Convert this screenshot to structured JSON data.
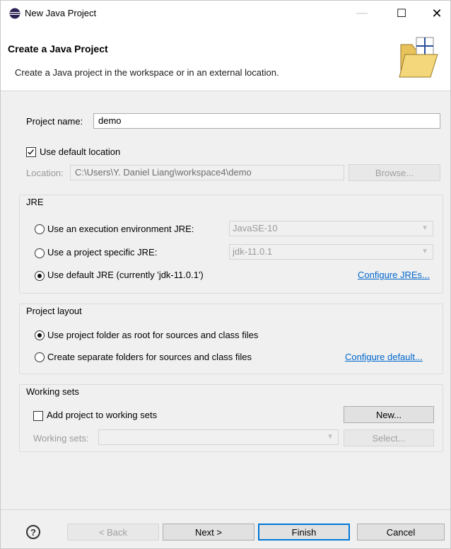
{
  "window": {
    "title": "New Java Project",
    "min_glyph": "—",
    "max_glyph": "☐",
    "close_glyph": "✕"
  },
  "header": {
    "title": "Create a Java Project",
    "description": "Create a Java project in the workspace or in an external location."
  },
  "project": {
    "name_label": "Project name:",
    "name_value": "demo",
    "use_default_location_label": "Use default location",
    "use_default_location_checked": true,
    "location_label": "Location:",
    "location_value": "C:\\Users\\Y. Daniel Liang\\workspace4\\demo",
    "browse_label": "Browse..."
  },
  "jre": {
    "group_label": "JRE",
    "option_env_label": "Use an execution environment JRE:",
    "option_env_value": "JavaSE-10",
    "option_specific_label": "Use a project specific JRE:",
    "option_specific_value": "jdk-11.0.1",
    "option_default_label": "Use default JRE (currently 'jdk-11.0.1')",
    "selected": "default",
    "configure_link": "Configure JREs..."
  },
  "layout": {
    "group_label": "Project layout",
    "option_root_label": "Use project folder as root for sources and class files",
    "option_separate_label": "Create separate folders for sources and class files",
    "selected": "root",
    "configure_link": "Configure default..."
  },
  "working_sets": {
    "group_label": "Working sets",
    "add_label": "Add project to working sets",
    "add_checked": false,
    "new_label": "New...",
    "sets_label": "Working sets:",
    "select_label": "Select..."
  },
  "footer": {
    "help_glyph": "?",
    "back_label": "< Back",
    "next_label": "Next >",
    "finish_label": "Finish",
    "cancel_label": "Cancel"
  },
  "colors": {
    "accent": "#0078d7",
    "link": "#0066cc"
  }
}
